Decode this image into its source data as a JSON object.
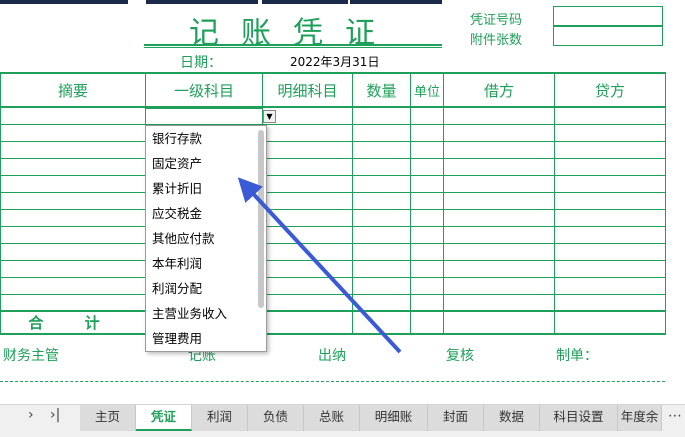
{
  "header": {
    "title": "记账凭证",
    "date_label": "日期：",
    "date_value": "2022年3月31日",
    "voucher_no_label": "凭证号码",
    "attachments_label": "附件张数"
  },
  "columns": [
    "摘要",
    "一级科目",
    "明细科目",
    "数量",
    "单位",
    "借方",
    "贷方"
  ],
  "total_label": "合 计",
  "footer": {
    "supervisor": "财务主管",
    "bookkeeper": "记账",
    "cashier": "出纳",
    "reviewer": "复核",
    "preparer": "制单："
  },
  "dropdown": {
    "items": [
      "银行存款",
      "固定资产",
      "累计折旧",
      "应交税金",
      "其他应付款",
      "本年利润",
      "利润分配",
      "主营业务收入",
      "管理费用"
    ]
  },
  "tabs": {
    "items": [
      "主页",
      "凭证",
      "利润",
      "负债",
      "总账",
      "明细账",
      "封面",
      "数据",
      "科目设置",
      "年度余"
    ],
    "active": "凭证",
    "more": "⋯"
  },
  "colors": {
    "grid": "#1ea05a",
    "arrow": "#3b5bd6"
  }
}
